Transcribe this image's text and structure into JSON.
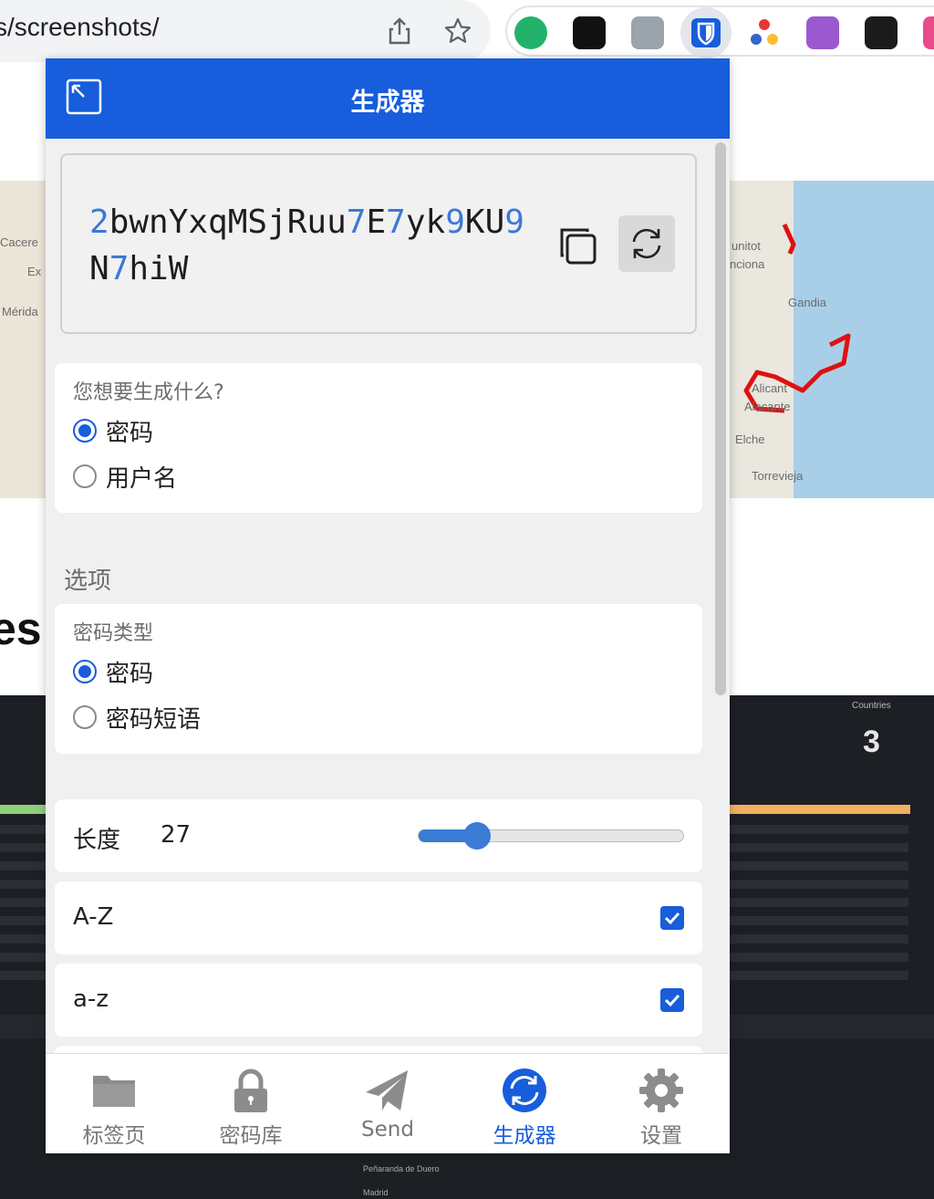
{
  "browser": {
    "url_fragment": "cs/screenshots/",
    "share_icon": "share-icon",
    "bookmark_icon": "star-icon",
    "extensions": [
      "y-extension-icon",
      "tab-extension-icon",
      "code-extension-icon",
      "bitwarden-shield-icon",
      "molecule-extension-icon",
      "purple-download-extension-icon",
      "dark-terminal-extension-icon",
      "pink-extension-icon"
    ]
  },
  "background_page": {
    "map_labels_right": [
      "unitot",
      "nciona",
      "Gandia",
      "Alicant",
      "Alacante",
      "Elche",
      "Torrevieja"
    ],
    "map_labels_left": [
      "Cacere",
      "Ex",
      "Mérida"
    ],
    "heading_fragment": "es",
    "stat_label": "Countries",
    "stat_value": "3",
    "footer_lines": [
      "Peñaranda de Duero",
      "Madrid"
    ]
  },
  "popup": {
    "title": "生成器",
    "popout_icon": "popout-icon",
    "password_segments": [
      {
        "t": "2",
        "digit": true
      },
      {
        "t": "bwnYxqMSjRuu",
        "digit": false
      },
      {
        "t": "7",
        "digit": true
      },
      {
        "t": "E",
        "digit": false
      },
      {
        "t": "7",
        "digit": true
      },
      {
        "t": "yk",
        "digit": false
      },
      {
        "t": "9",
        "digit": true
      },
      {
        "t": "KU",
        "digit": false
      },
      {
        "t": "9",
        "digit": true
      },
      {
        "t": "N",
        "digit": false
      },
      {
        "t": "7",
        "digit": true
      },
      {
        "t": "hiW",
        "digit": false
      }
    ],
    "copy_icon": "copy-icon",
    "regenerate_icon": "refresh-icon",
    "what_to_generate": {
      "label": "您想要生成什么?",
      "options": [
        {
          "label": "密码",
          "selected": true
        },
        {
          "label": "用户名",
          "selected": false
        }
      ]
    },
    "options_title": "选项",
    "password_type": {
      "label": "密码类型",
      "options": [
        {
          "label": "密码",
          "selected": true
        },
        {
          "label": "密码短语",
          "selected": false
        }
      ]
    },
    "length": {
      "label": "长度",
      "value": "27",
      "slider_fraction": 0.22
    },
    "uppercase": {
      "label": "A-Z",
      "checked": true
    },
    "lowercase": {
      "label": "a-z",
      "checked": true
    },
    "accent_color": "#175ddc",
    "nav": [
      {
        "label": "标签页",
        "icon": "folder-icon",
        "active": false
      },
      {
        "label": "密码库",
        "icon": "lock-icon",
        "active": false
      },
      {
        "label": "Send",
        "icon": "send-icon",
        "active": false
      },
      {
        "label": "生成器",
        "icon": "generator-icon",
        "active": true
      },
      {
        "label": "设置",
        "icon": "gear-icon",
        "active": false
      }
    ]
  }
}
